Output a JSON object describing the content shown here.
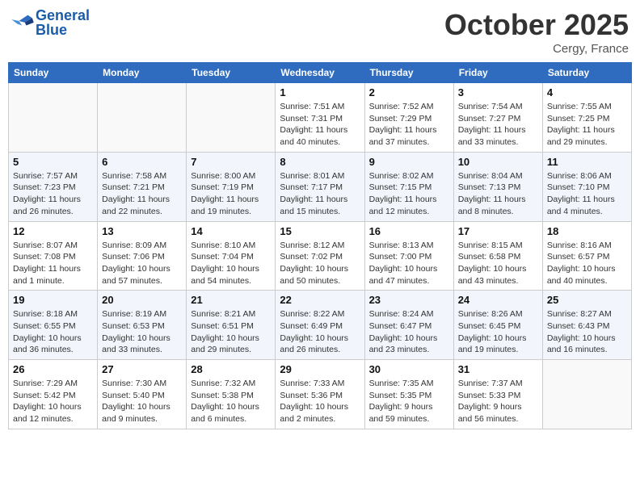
{
  "header": {
    "logo_line1": "General",
    "logo_line2": "Blue",
    "month": "October 2025",
    "location": "Cergy, France"
  },
  "days_of_week": [
    "Sunday",
    "Monday",
    "Tuesday",
    "Wednesday",
    "Thursday",
    "Friday",
    "Saturday"
  ],
  "weeks": [
    [
      {
        "day": "",
        "sunrise": "",
        "sunset": "",
        "daylight": ""
      },
      {
        "day": "",
        "sunrise": "",
        "sunset": "",
        "daylight": ""
      },
      {
        "day": "",
        "sunrise": "",
        "sunset": "",
        "daylight": ""
      },
      {
        "day": "1",
        "sunrise": "Sunrise: 7:51 AM",
        "sunset": "Sunset: 7:31 PM",
        "daylight": "Daylight: 11 hours and 40 minutes."
      },
      {
        "day": "2",
        "sunrise": "Sunrise: 7:52 AM",
        "sunset": "Sunset: 7:29 PM",
        "daylight": "Daylight: 11 hours and 37 minutes."
      },
      {
        "day": "3",
        "sunrise": "Sunrise: 7:54 AM",
        "sunset": "Sunset: 7:27 PM",
        "daylight": "Daylight: 11 hours and 33 minutes."
      },
      {
        "day": "4",
        "sunrise": "Sunrise: 7:55 AM",
        "sunset": "Sunset: 7:25 PM",
        "daylight": "Daylight: 11 hours and 29 minutes."
      }
    ],
    [
      {
        "day": "5",
        "sunrise": "Sunrise: 7:57 AM",
        "sunset": "Sunset: 7:23 PM",
        "daylight": "Daylight: 11 hours and 26 minutes."
      },
      {
        "day": "6",
        "sunrise": "Sunrise: 7:58 AM",
        "sunset": "Sunset: 7:21 PM",
        "daylight": "Daylight: 11 hours and 22 minutes."
      },
      {
        "day": "7",
        "sunrise": "Sunrise: 8:00 AM",
        "sunset": "Sunset: 7:19 PM",
        "daylight": "Daylight: 11 hours and 19 minutes."
      },
      {
        "day": "8",
        "sunrise": "Sunrise: 8:01 AM",
        "sunset": "Sunset: 7:17 PM",
        "daylight": "Daylight: 11 hours and 15 minutes."
      },
      {
        "day": "9",
        "sunrise": "Sunrise: 8:02 AM",
        "sunset": "Sunset: 7:15 PM",
        "daylight": "Daylight: 11 hours and 12 minutes."
      },
      {
        "day": "10",
        "sunrise": "Sunrise: 8:04 AM",
        "sunset": "Sunset: 7:13 PM",
        "daylight": "Daylight: 11 hours and 8 minutes."
      },
      {
        "day": "11",
        "sunrise": "Sunrise: 8:06 AM",
        "sunset": "Sunset: 7:10 PM",
        "daylight": "Daylight: 11 hours and 4 minutes."
      }
    ],
    [
      {
        "day": "12",
        "sunrise": "Sunrise: 8:07 AM",
        "sunset": "Sunset: 7:08 PM",
        "daylight": "Daylight: 11 hours and 1 minute."
      },
      {
        "day": "13",
        "sunrise": "Sunrise: 8:09 AM",
        "sunset": "Sunset: 7:06 PM",
        "daylight": "Daylight: 10 hours and 57 minutes."
      },
      {
        "day": "14",
        "sunrise": "Sunrise: 8:10 AM",
        "sunset": "Sunset: 7:04 PM",
        "daylight": "Daylight: 10 hours and 54 minutes."
      },
      {
        "day": "15",
        "sunrise": "Sunrise: 8:12 AM",
        "sunset": "Sunset: 7:02 PM",
        "daylight": "Daylight: 10 hours and 50 minutes."
      },
      {
        "day": "16",
        "sunrise": "Sunrise: 8:13 AM",
        "sunset": "Sunset: 7:00 PM",
        "daylight": "Daylight: 10 hours and 47 minutes."
      },
      {
        "day": "17",
        "sunrise": "Sunrise: 8:15 AM",
        "sunset": "Sunset: 6:58 PM",
        "daylight": "Daylight: 10 hours and 43 minutes."
      },
      {
        "day": "18",
        "sunrise": "Sunrise: 8:16 AM",
        "sunset": "Sunset: 6:57 PM",
        "daylight": "Daylight: 10 hours and 40 minutes."
      }
    ],
    [
      {
        "day": "19",
        "sunrise": "Sunrise: 8:18 AM",
        "sunset": "Sunset: 6:55 PM",
        "daylight": "Daylight: 10 hours and 36 minutes."
      },
      {
        "day": "20",
        "sunrise": "Sunrise: 8:19 AM",
        "sunset": "Sunset: 6:53 PM",
        "daylight": "Daylight: 10 hours and 33 minutes."
      },
      {
        "day": "21",
        "sunrise": "Sunrise: 8:21 AM",
        "sunset": "Sunset: 6:51 PM",
        "daylight": "Daylight: 10 hours and 29 minutes."
      },
      {
        "day": "22",
        "sunrise": "Sunrise: 8:22 AM",
        "sunset": "Sunset: 6:49 PM",
        "daylight": "Daylight: 10 hours and 26 minutes."
      },
      {
        "day": "23",
        "sunrise": "Sunrise: 8:24 AM",
        "sunset": "Sunset: 6:47 PM",
        "daylight": "Daylight: 10 hours and 23 minutes."
      },
      {
        "day": "24",
        "sunrise": "Sunrise: 8:26 AM",
        "sunset": "Sunset: 6:45 PM",
        "daylight": "Daylight: 10 hours and 19 minutes."
      },
      {
        "day": "25",
        "sunrise": "Sunrise: 8:27 AM",
        "sunset": "Sunset: 6:43 PM",
        "daylight": "Daylight: 10 hours and 16 minutes."
      }
    ],
    [
      {
        "day": "26",
        "sunrise": "Sunrise: 7:29 AM",
        "sunset": "Sunset: 5:42 PM",
        "daylight": "Daylight: 10 hours and 12 minutes."
      },
      {
        "day": "27",
        "sunrise": "Sunrise: 7:30 AM",
        "sunset": "Sunset: 5:40 PM",
        "daylight": "Daylight: 10 hours and 9 minutes."
      },
      {
        "day": "28",
        "sunrise": "Sunrise: 7:32 AM",
        "sunset": "Sunset: 5:38 PM",
        "daylight": "Daylight: 10 hours and 6 minutes."
      },
      {
        "day": "29",
        "sunrise": "Sunrise: 7:33 AM",
        "sunset": "Sunset: 5:36 PM",
        "daylight": "Daylight: 10 hours and 2 minutes."
      },
      {
        "day": "30",
        "sunrise": "Sunrise: 7:35 AM",
        "sunset": "Sunset: 5:35 PM",
        "daylight": "Daylight: 9 hours and 59 minutes."
      },
      {
        "day": "31",
        "sunrise": "Sunrise: 7:37 AM",
        "sunset": "Sunset: 5:33 PM",
        "daylight": "Daylight: 9 hours and 56 minutes."
      },
      {
        "day": "",
        "sunrise": "",
        "sunset": "",
        "daylight": ""
      }
    ]
  ]
}
